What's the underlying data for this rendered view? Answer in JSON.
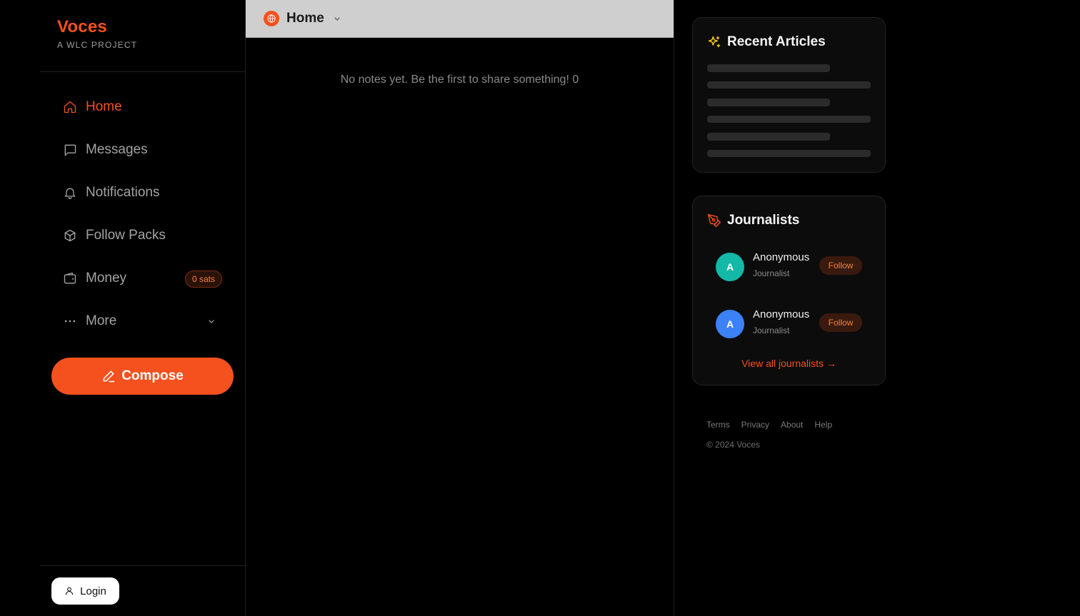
{
  "brand": {
    "name": "Voces",
    "subtitle": "A WLC PROJECT"
  },
  "nav": {
    "items": [
      {
        "label": "Home",
        "icon": "home-icon",
        "active": true
      },
      {
        "label": "Messages",
        "icon": "message-icon"
      },
      {
        "label": "Notifications",
        "icon": "bell-icon"
      },
      {
        "label": "Follow Packs",
        "icon": "package-icon"
      },
      {
        "label": "Money",
        "icon": "wallet-icon",
        "badge": "0 sats"
      },
      {
        "label": "More",
        "icon": "ellipsis-icon"
      }
    ]
  },
  "compose": {
    "label": "Compose"
  },
  "login": {
    "label": "Login"
  },
  "feed": {
    "title": "Home",
    "empty_message": "No notes yet. Be the first to share something! 0"
  },
  "articles": {
    "title": "Recent Articles"
  },
  "journalists": {
    "title": "Journalists",
    "items": [
      {
        "initial": "A",
        "name": "Anonymous",
        "role": "Journalist",
        "follow": "Follow",
        "color": "#14b8a6"
      },
      {
        "initial": "A",
        "name": "Anonymous",
        "role": "Journalist",
        "follow": "Follow",
        "color": "#3b82f6"
      }
    ],
    "view_all": "View all journalists →"
  },
  "footer": {
    "links": [
      "Terms",
      "Privacy",
      "About",
      "Help"
    ],
    "copyright": "© 2024 Voces"
  },
  "colors": {
    "accent": "#f4511e",
    "background": "#000000"
  }
}
